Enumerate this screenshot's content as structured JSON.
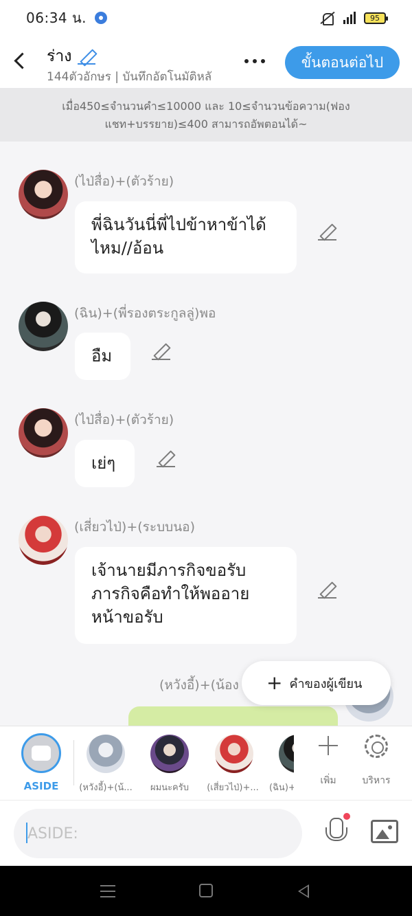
{
  "status_bar": {
    "time": "06:34 น.",
    "battery": "95"
  },
  "header": {
    "title": "ร่าง",
    "subtitle": "144ตัวอักษร | บันทึกอัตโนมัติหลั",
    "next_button": "ขั้นตอนต่อไป"
  },
  "notice": "เมื่อ450≤จำนวนคำ≤10000 และ 10≤จำนวนข้อความ(ฟองแชท+บรรยาย)≤400 สามารถอัพตอนได้~",
  "messages": [
    {
      "sender": "(ไป่สื่อ)+(ตัวร้าย)",
      "text": "พี่ฉินวันนี่พี่ไปข้าหาข้าได้ไหม//อ้อน"
    },
    {
      "sender": "(ฉิน)+(พี่รองตระกูลลู่)พอ",
      "text": "อืม"
    },
    {
      "sender": "(ไป่สื่อ)+(ตัวร้าย)",
      "text": "เย่ๆ"
    },
    {
      "sender": "(เสี่ยวไป่)+(ระบบนอ)",
      "text": "เจ้านายมีภารกิจขอรับภารกิจคือทำให้พออายหน้าขอรับ"
    },
    {
      "sender": "(หวังอี้)+(น้อง"
    }
  ],
  "author_button": "คำของผู้เขียน",
  "characters": {
    "aside": "ASIDE",
    "items": [
      "(หวังอี้)+(น้...",
      "ผมนะครับ",
      "(เสี่ยวไป่)+...",
      "(ฉิน)+"
    ],
    "add_label": "เพิ่ม",
    "manage_label": "บริหาร"
  },
  "input": {
    "placeholder": "ASIDE:"
  }
}
